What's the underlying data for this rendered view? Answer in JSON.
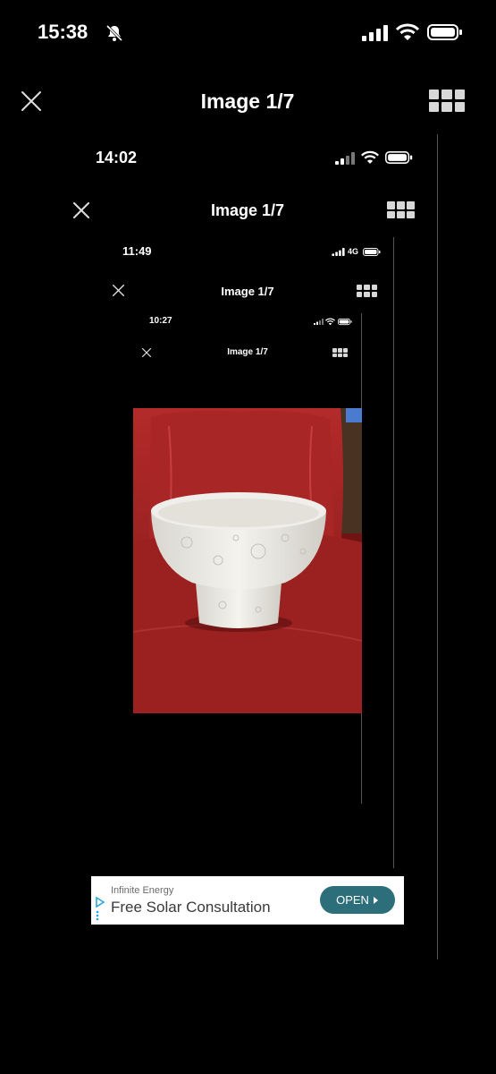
{
  "level1": {
    "time": "15:38",
    "title": "Image 1/7"
  },
  "level2": {
    "time": "14:02",
    "title": "Image 1/7"
  },
  "level3": {
    "time": "11:49",
    "network": "4G",
    "title": "Image 1/7"
  },
  "level4": {
    "time": "10:27",
    "title": "Image 1/7"
  },
  "ad": {
    "sponsor": "Infinite Energy",
    "headline": "Free Solar Consultation",
    "button": "OPEN"
  },
  "colors": {
    "background": "#000000",
    "ad_button": "#2c6f7a",
    "chair_red": "#9e2323",
    "bowl_white": "#efefe9"
  },
  "icons": [
    "bell-slash-icon",
    "signal-icon",
    "wifi-icon",
    "battery-icon",
    "close-icon",
    "grid-icon",
    "adchoices-icon",
    "chevron-right-icon"
  ]
}
